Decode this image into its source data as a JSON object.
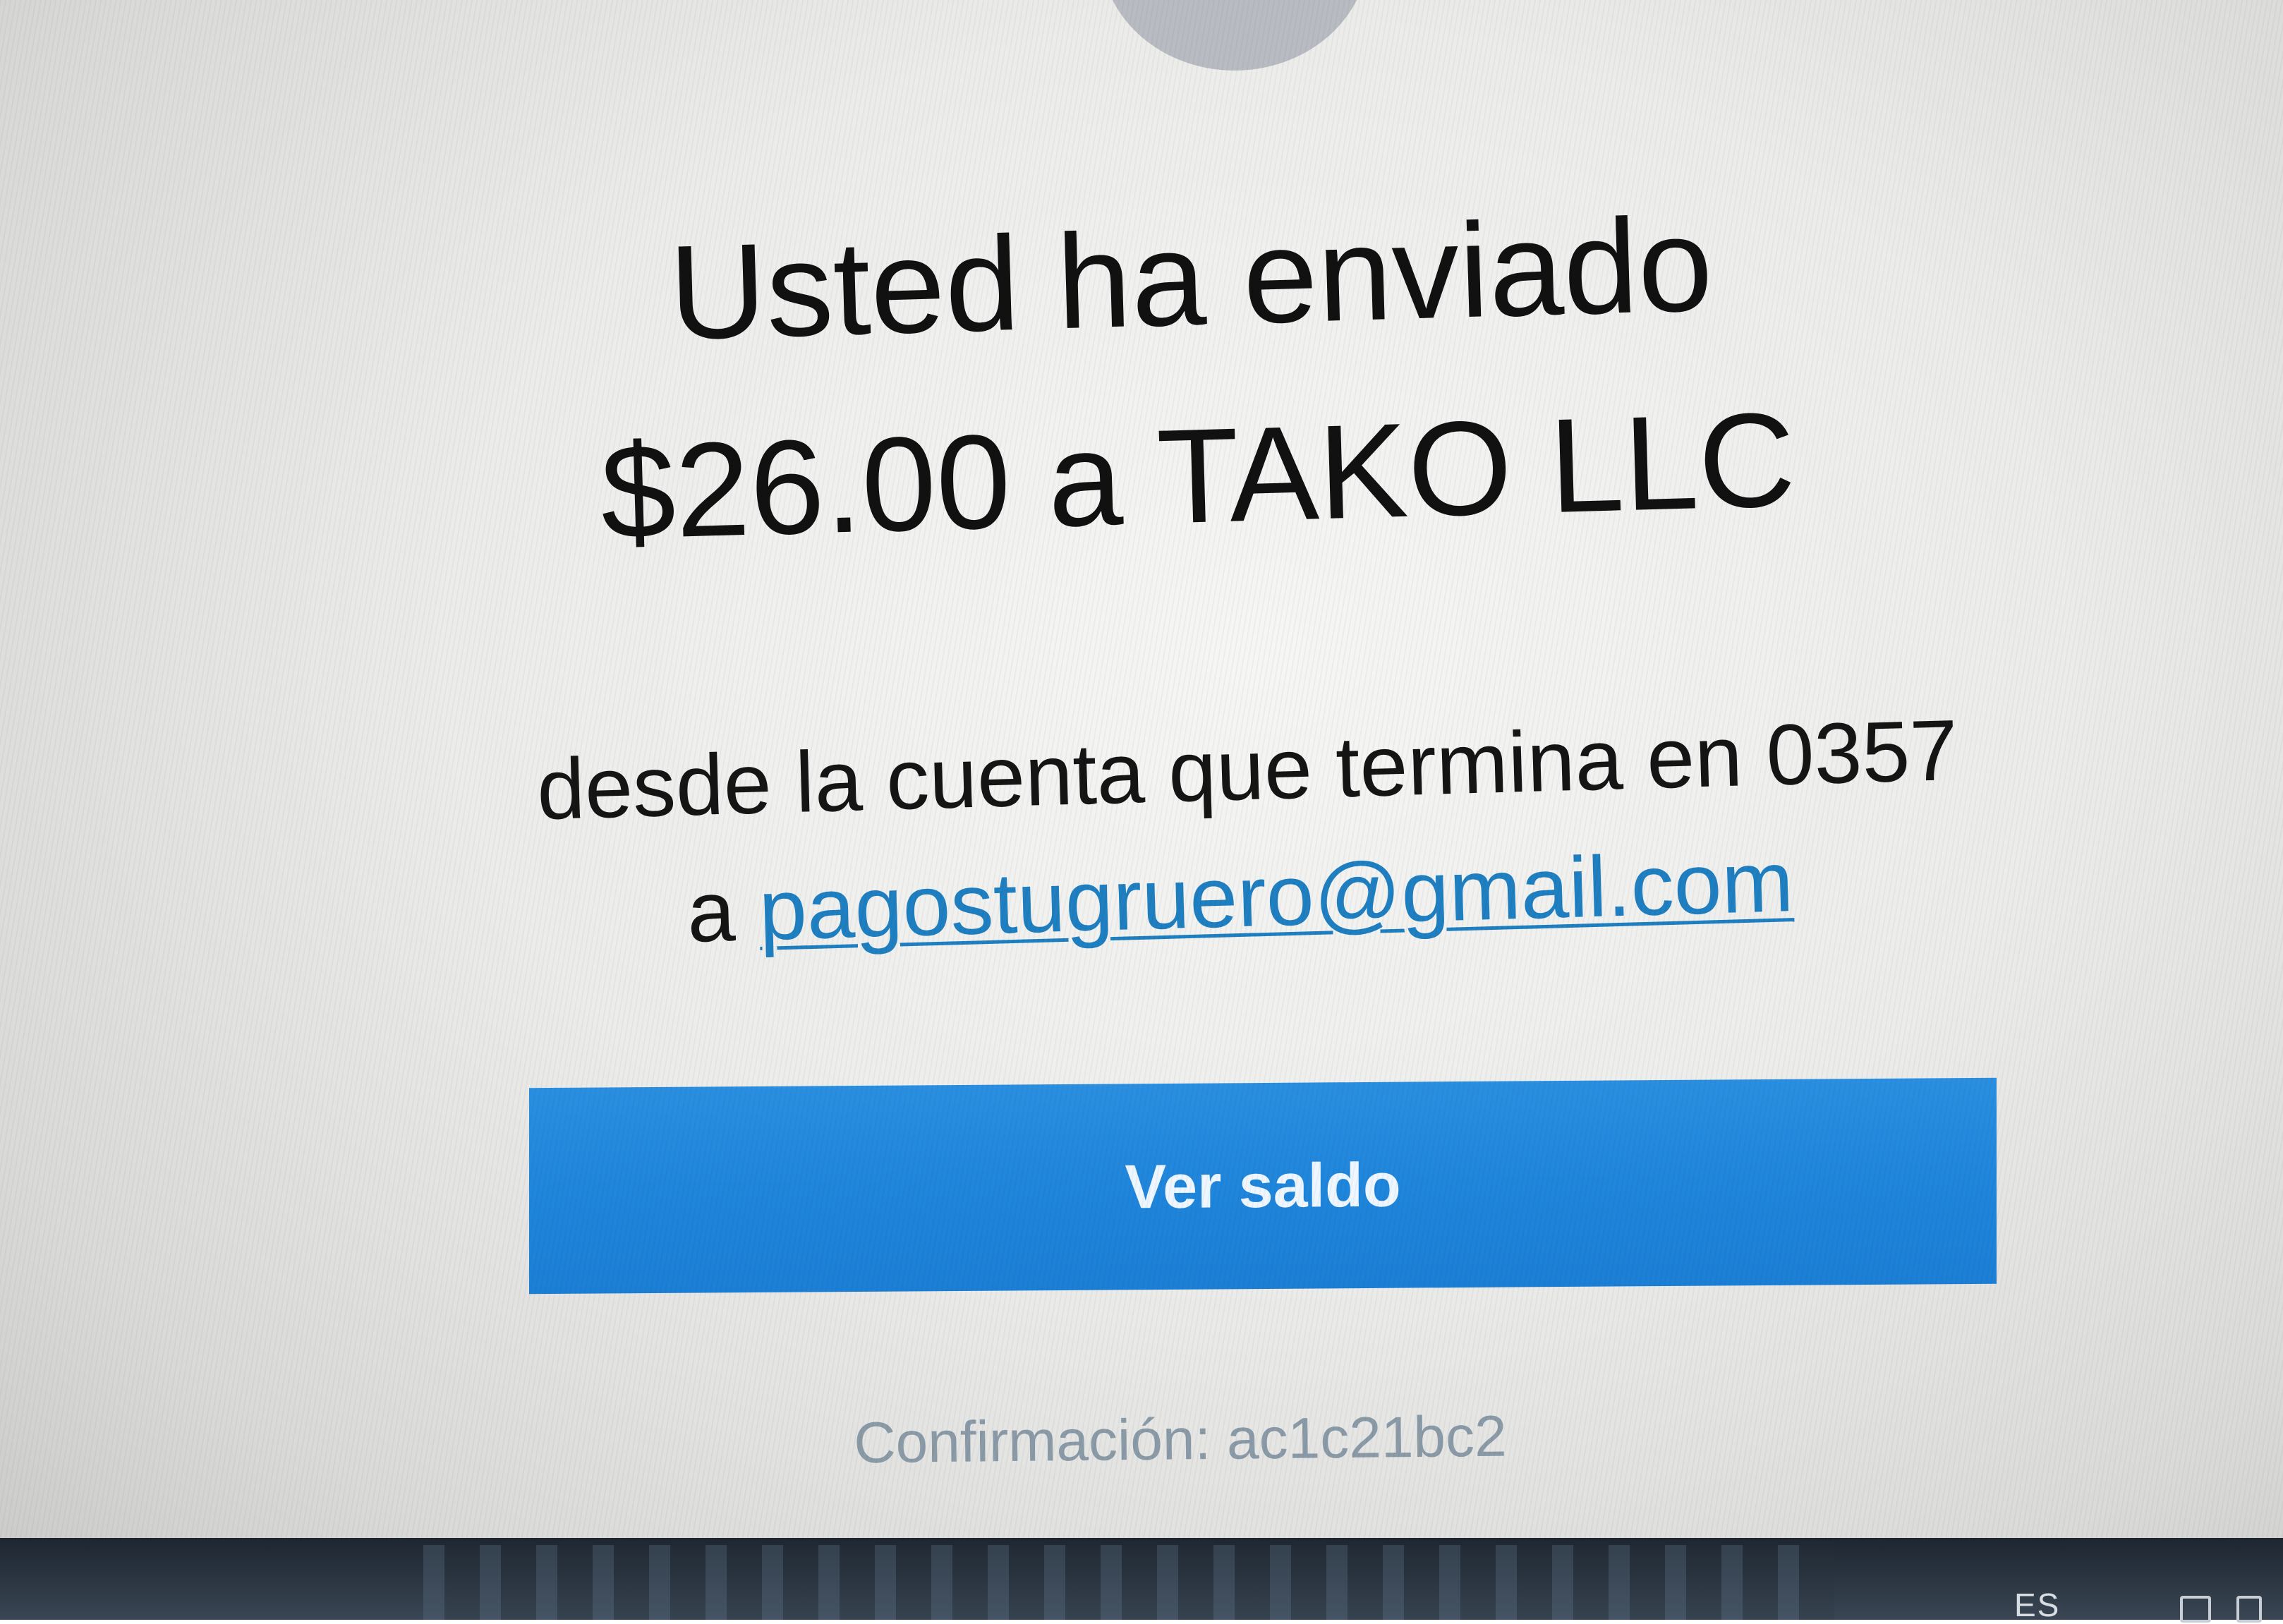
{
  "confirmation_page": {
    "headline_line1": "Usted ha enviado",
    "headline_line2": "$26.00 a TAKO LLC",
    "account_line": "desde la cuenta que termina en 0357",
    "recipient_prefix": "a",
    "recipient_email": "pagostugruero@gmail.com",
    "view_balance_button": "Ver saldo",
    "confirmation_label": "Confirmación:",
    "confirmation_code": "ac1c21bc2"
  },
  "taskbar": {
    "language": "ES"
  },
  "colors": {
    "button_blue": "#1f86dc",
    "link_blue": "#1f7fc1",
    "confirmation_gray": "#8a9aa7",
    "brand_red": "#c8102e"
  },
  "icons": {
    "top_logo": "brand-logo",
    "tray": [
      "network-icon",
      "battery-icon"
    ]
  }
}
